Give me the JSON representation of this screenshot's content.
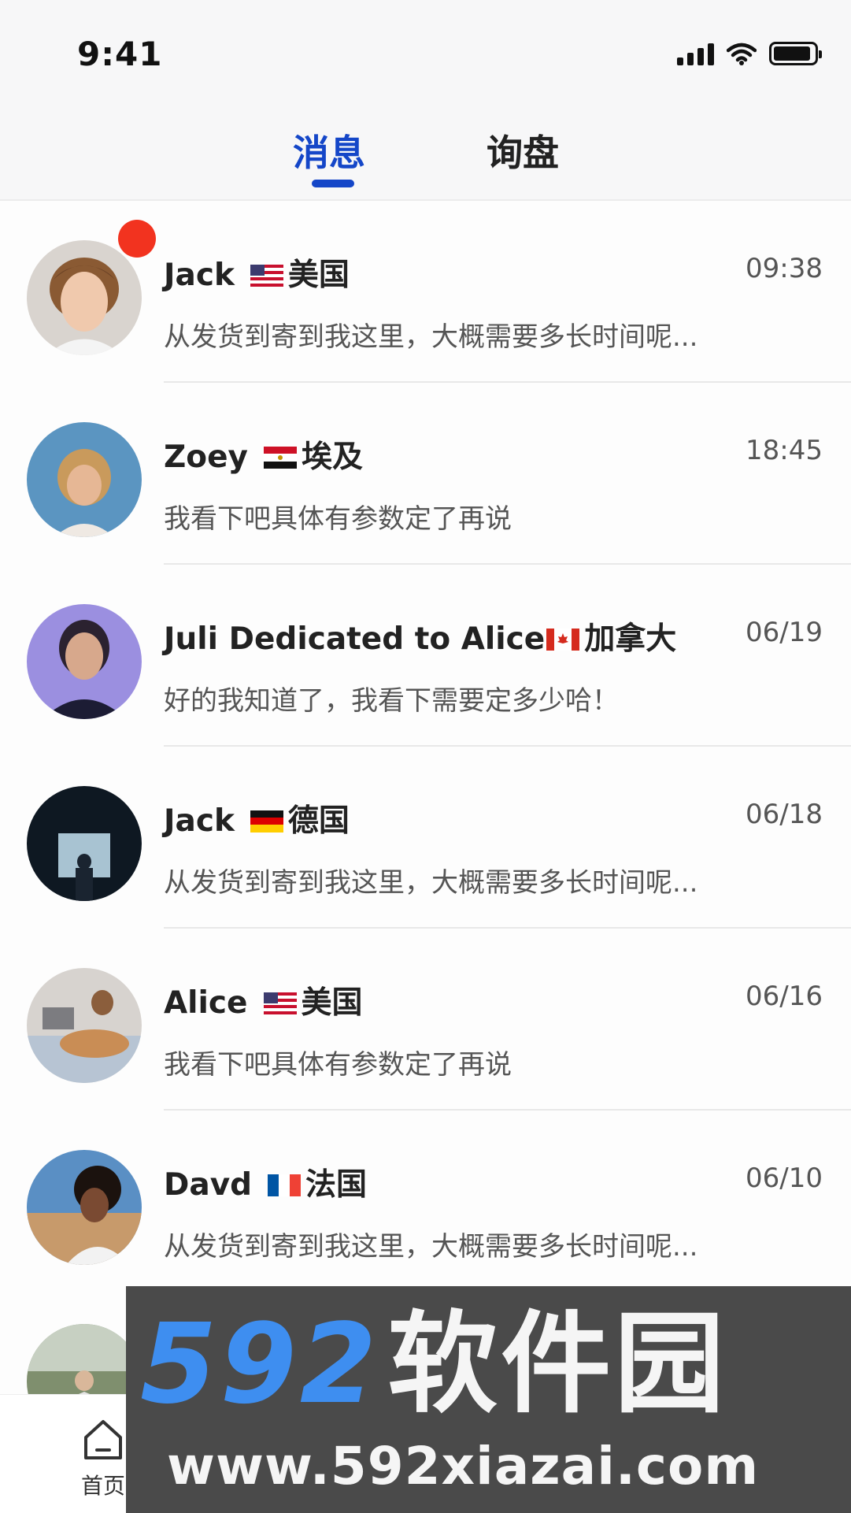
{
  "status_bar": {
    "time": "9:41"
  },
  "tabs": [
    {
      "label": "消息",
      "active": true
    },
    {
      "label": "询盘",
      "active": false
    }
  ],
  "colors": {
    "accent": "#1446c8",
    "unread": "#f2331f",
    "divider": "#e8e8e8"
  },
  "messages": [
    {
      "name": "Jack",
      "flag": "us-flag",
      "country": "美国",
      "time": "09:38",
      "preview": "从发货到寄到我这里，大概需要多长时间呢...",
      "unread": true
    },
    {
      "name": "Zoey",
      "flag": "egypt-flag",
      "country": "埃及",
      "time": "18:45",
      "preview": "我看下吧具体有参数定了再说",
      "unread": false
    },
    {
      "name": "Juli  Dedicated to Alice",
      "flag": "canada-flag",
      "country": "加拿大",
      "time": "06/19",
      "preview": "好的我知道了，我看下需要定多少哈！",
      "unread": false
    },
    {
      "name": "Jack",
      "flag": "germany-flag",
      "country": "德国",
      "time": "06/18",
      "preview": "从发货到寄到我这里，大概需要多长时间呢...",
      "unread": false
    },
    {
      "name": "Alice",
      "flag": "us-flag",
      "country": "美国",
      "time": "06/16",
      "preview": "我看下吧具体有参数定了再说",
      "unread": false
    },
    {
      "name": "Davd",
      "flag": "france-flag",
      "country": "法国",
      "time": "06/10",
      "preview": "从发货到寄到我这里，大概需要多长时间呢...",
      "unread": false
    }
  ],
  "bottom_nav": {
    "home_label": "首页",
    "home_icon": "home-icon"
  },
  "watermark": {
    "logo_num": "592",
    "logo_cn": "软件园",
    "url": "www.592xiazai.com"
  }
}
